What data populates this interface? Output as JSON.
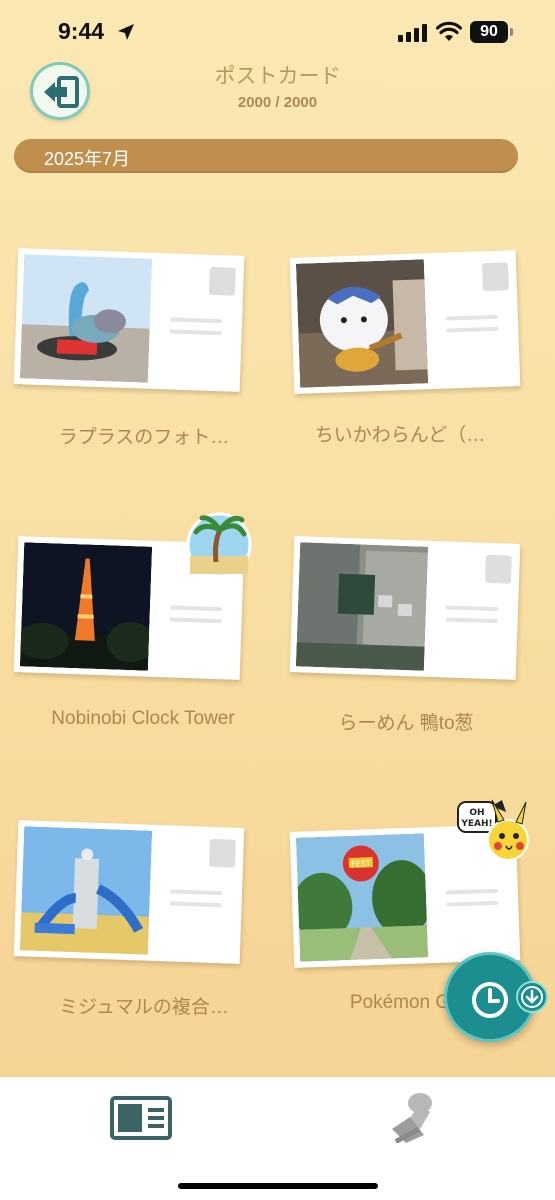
{
  "status_bar": {
    "time": "9:44",
    "battery": "90"
  },
  "header": {
    "title": "ポストカード",
    "count": "2000 / 2000"
  },
  "month_banner": {
    "label": "2025年7月"
  },
  "postcards": [
    {
      "caption": "ラプラスのフォト…",
      "photo": "lapras-photo"
    },
    {
      "caption": "ちいかわらんど（…",
      "photo": "chiikawa-photo"
    },
    {
      "caption": "Nobinobi Clock Tower",
      "photo": "tower-photo"
    },
    {
      "caption": "らーめん 鴨to葱",
      "photo": "ramen-shop-photo"
    },
    {
      "caption": "ミジュマルの複合…",
      "photo": "playground-photo"
    },
    {
      "caption": "Pokémon G",
      "photo": "gofest-photo"
    }
  ],
  "stickers": {
    "pikachu_text": "OH YEAH!",
    "gofest_text": "GO FEST"
  },
  "bottom_nav": {
    "tabs": [
      "postcards-tab",
      "stamps-tab"
    ]
  },
  "colors": {
    "accent": "#c08f4e",
    "caption": "#b08650",
    "teal": "#1d8e8f"
  }
}
